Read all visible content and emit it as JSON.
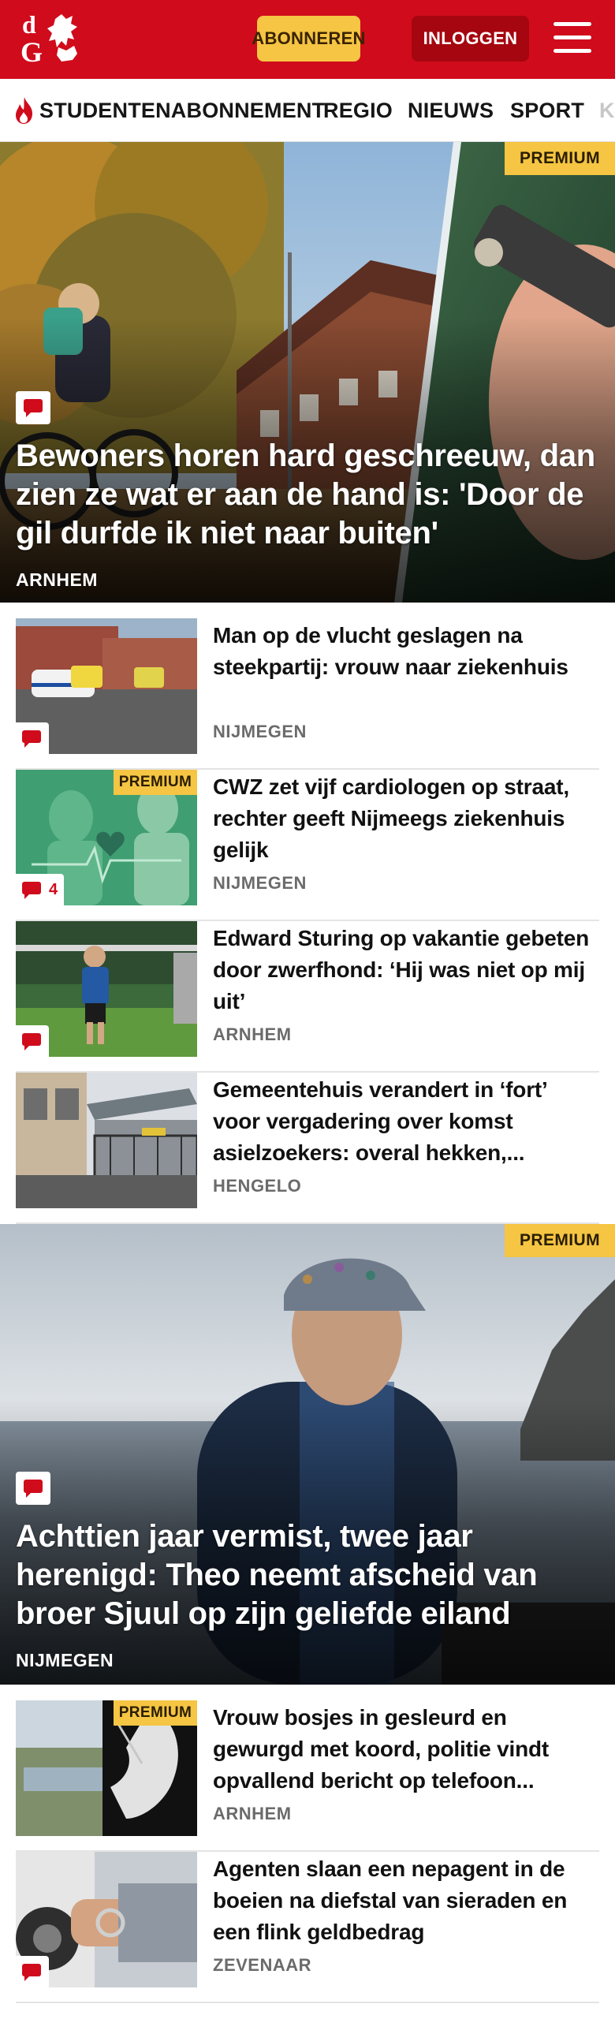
{
  "header": {
    "logo_text": "dG",
    "subscribe_label": "ABONNEREN",
    "login_label": "INLOGGEN",
    "menu_icon": "hamburger-menu-icon",
    "brand_color": "#d00b1c"
  },
  "nav": {
    "items": [
      {
        "label": "STUDENTENABONNEMENT",
        "icon": "fire-icon"
      },
      {
        "label": "REGIO"
      },
      {
        "label": "NIEUWS"
      },
      {
        "label": "SPORT"
      },
      {
        "label": "K"
      }
    ]
  },
  "hero1": {
    "premium_label": "PREMIUM",
    "title": "Bewoners horen hard geschreeuw, dan zien ze wat er aan de hand is: 'Door de gil durfde ik niet naar buiten'",
    "region": "ARNHEM"
  },
  "articles": [
    {
      "title": "Man op de vlucht geslagen na steekpartij: vrouw naar ziekenhuis",
      "region": "NIJMEGEN",
      "premium": false,
      "comments": ""
    },
    {
      "title": "CWZ zet vijf cardiologen op straat, rechter geeft Nijmeegs ziekenhuis gelijk",
      "region": "NIJMEGEN",
      "premium": true,
      "premium_label": "PREMIUM",
      "comments": "4"
    },
    {
      "title": "Edward Sturing op vakantie gebeten door zwerfhond: ‘Hij was niet op mij uit’",
      "region": "ARNHEM",
      "premium": false,
      "comments": ""
    },
    {
      "title": "Gemeentehuis verandert in ‘fort’ voor vergadering over komst asielzoekers: overal hekken,...",
      "region": "HENGELO",
      "premium": false
    }
  ],
  "hero2": {
    "premium_label": "PREMIUM",
    "title": "Achttien jaar vermist, twee jaar herenigd: Theo neemt afscheid van broer Sjuul op zijn geliefde eiland",
    "region": "NIJMEGEN"
  },
  "articles2": [
    {
      "title": "Vrouw bosjes in gesleurd en gewurgd met koord, politie vindt opvallend bericht op telefoon...",
      "region": "ARNHEM",
      "premium": true,
      "premium_label": "PREMIUM"
    },
    {
      "title": "Agenten slaan een nepagent in de boeien na diefstal van sieraden en een flink geldbedrag",
      "region": "ZEVENAAR",
      "premium": false,
      "comments": ""
    }
  ]
}
